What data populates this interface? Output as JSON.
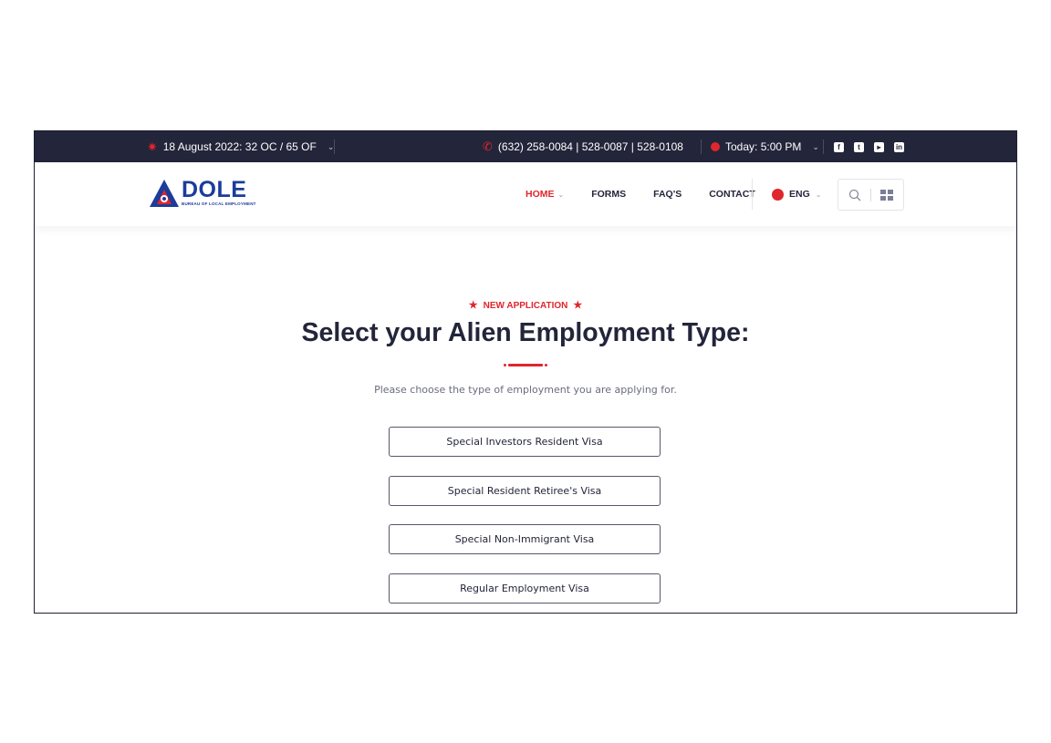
{
  "topbar": {
    "weather": "18 August 2022: 32 OC / 65 OF",
    "phone": "(632) 258-0084 | 528-0087 | 528-0108",
    "hours": "Today: 5:00 PM",
    "social_icons": [
      "facebook-icon",
      "twitter-icon",
      "youtube-icon",
      "linkedin-icon"
    ]
  },
  "header": {
    "logo_text": "DOLE",
    "logo_subtext": "BUREAU OF LOCAL EMPLOYMENT",
    "nav": [
      {
        "label": "HOME",
        "active": true
      },
      {
        "label": "FORMS"
      },
      {
        "label": "FAQ'S"
      },
      {
        "label": "CONTACT"
      }
    ],
    "language": "ENG"
  },
  "main": {
    "eyebrow": "NEW APPLICATION",
    "title": "Select your Alien Employment Type:",
    "subtitle": "Please choose the type of employment you are applying for.",
    "options": [
      "Special Investors Resident Visa",
      "Special Resident Retiree's Visa",
      "Special Non-Immigrant Visa",
      "Regular Employment Visa"
    ]
  },
  "colors": {
    "accent": "#e0262d",
    "dark": "#23253a",
    "brand_blue": "#1b3c9a"
  }
}
